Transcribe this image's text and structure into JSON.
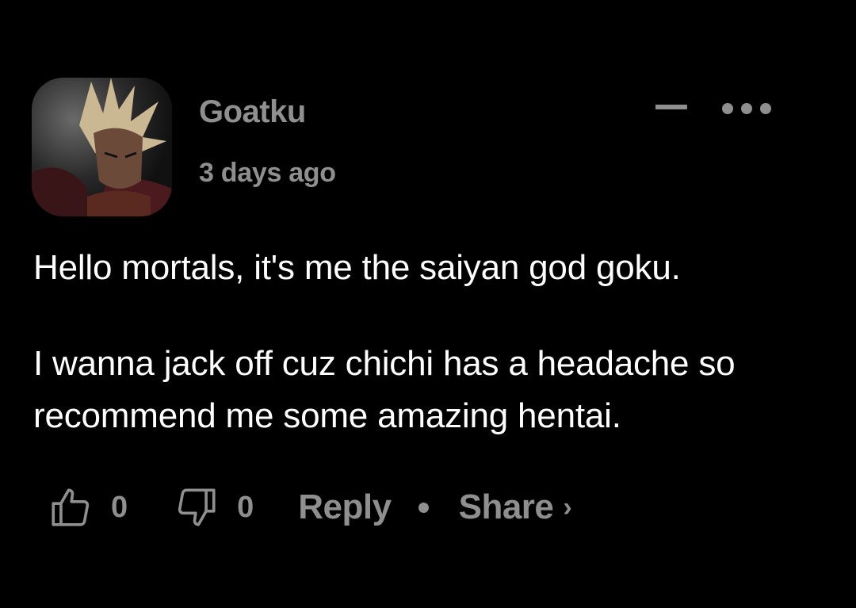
{
  "comment": {
    "username": "Goatku",
    "timestamp": "3 days ago",
    "body": [
      "Hello mortals, it's me the saiyan god goku.",
      "I wanna jack off cuz chichi has a headache so recommend me some amazing hentai."
    ]
  },
  "actions": {
    "likes": "0",
    "dislikes": "0",
    "reply_label": "Reply",
    "share_label": "Share",
    "share_chevron": "›"
  },
  "icons": {
    "avatar": "avatar-image",
    "collapse": "minus-icon",
    "more": "more-dots-icon",
    "like": "thumbs-up-icon",
    "dislike": "thumbs-down-icon",
    "share_arrow": "chevron-right-icon"
  },
  "colors": {
    "background": "#000000",
    "muted_text": "#8f8f8f",
    "body_text": "#ffffff"
  }
}
